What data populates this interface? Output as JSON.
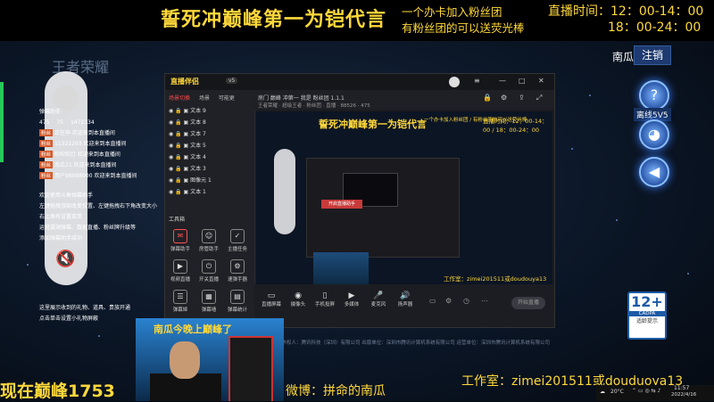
{
  "banner": {
    "title": "誓死冲巅峰第一为铠代言",
    "fan_line1": "一个办卡加入粉丝团",
    "fan_line2": "有粉丝团的可以送荧光棒",
    "live_time1": "直播时间：12：00-14：00",
    "live_time2": "18：00-24：00"
  },
  "game": {
    "logo_text": "王者荣耀",
    "player_name": "南瓜",
    "logout_label": "注销",
    "mode_label": "离线5V5",
    "help_icon": "question-icon",
    "controller_icon": "gamepad-icon",
    "sound_icon": "speaker-icon"
  },
  "chat": {
    "header": "弹幕助手",
    "stats": [
      "475",
      "75",
      "1472334"
    ],
    "rows": [
      {
        "badge": "粉丝",
        "text": "正在申 欢迎来到本直播间"
      },
      {
        "badge": "粉丝",
        "text": "11322293 欢迎来到本直播间"
      },
      {
        "badge": "粉丝",
        "text": "吹吹吹灯 欢迎来到本直播间"
      },
      {
        "badge": "粉丝",
        "text": "南瓜21 欢迎来到本直播间"
      },
      {
        "badge": "粉丝",
        "text": "用户98098000 欢迎来到本直播间"
      }
    ],
    "help1": "欢迎使用斗鱼弹幕助手",
    "help2": "左键拖拽顶部改变位置、左键拖拽右下角改变大小",
    "help3": "右上角有设置菜单",
    "help4": "运营漏洞弹幕、数据直播、粉丝牌升级等",
    "help5": "添加弹幕助手成功",
    "footer1": "这里展示收到的礼物、道具、贵族开通",
    "footer2": "点击单击设置小礼物屏蔽"
  },
  "app": {
    "logo": "直播伴侣",
    "version": "v5",
    "tabs": [
      "场景切换",
      "场景",
      "可能更"
    ],
    "scenes": [
      "文本 9",
      "文本 8",
      "文本 7",
      "文本 5",
      "文本 4",
      "文本 3",
      "图像元 1",
      "文本 1"
    ],
    "tool_title": "工具箱",
    "tools": [
      "弹幕助手",
      "房管助手",
      "主播任务",
      "视频直播",
      "开关直播",
      "速弹手器",
      "弹幕姬",
      "弹幕墙",
      "弹幕统计"
    ],
    "scene_info": "房门 巅峰 冲第一 我是 粉丝团 1.1.1",
    "scene_tags": "王者荣耀 · 超级王者 · 粉丝团 · 直播 · 88526 · 475",
    "bottom_buttons": [
      "直播屏幕",
      "摄像头",
      "手机投屏",
      "多媒体",
      "麦克风",
      "扬声器"
    ],
    "start_label": "开始直播",
    "preview_title": "誓死冲巅峰第一为铠代言",
    "preview_fan": "一个办卡加入粉丝团 / 有粉丝团的可以送荧光棒",
    "preview_live": "直播时间：12：00-14：00 / 18：00-24：00",
    "preview_studio": "工作室：zimei201511或doudouya13",
    "preview_red_btn": "开启直播助手"
  },
  "cadpa": {
    "age": "12+",
    "label": "CADPA",
    "sub": "适龄提示"
  },
  "footer": {
    "notice": "操作权人：腾讯科技（深圳）有限公司  出版单位：深圳市腾讯计算机系统有限公司  运营单位：深圳市腾讯计算机系统有限公司",
    "cam_banner": "南瓜今晚上巅峰了",
    "peak": "现在巅峰1753",
    "weibo": "微博：拼命的南瓜",
    "studio": "工作室：zimei201511或douduoya13",
    "temp": "20°C",
    "clock_time": "11:57",
    "clock_date": "2022/4/16"
  },
  "colors": {
    "banner_text": "#ffd83a",
    "accent_red": "#ff4a4a",
    "cadpa_blue": "#1c5aa6"
  }
}
